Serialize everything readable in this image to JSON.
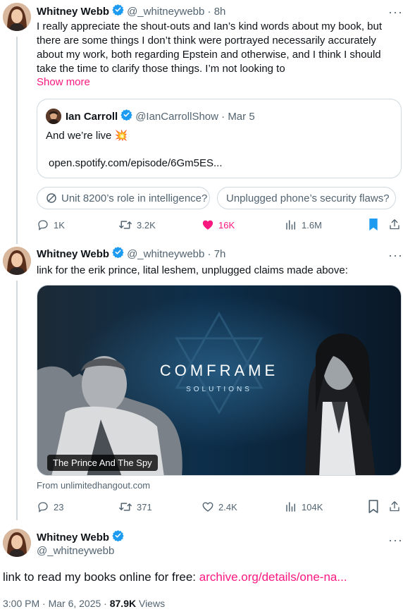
{
  "tweet1": {
    "name": "Whitney Webb",
    "handle": "@_whitneywebb",
    "time": "8h",
    "text": "I really appreciate the shout-outs and Ian’s kind words about my book, but there are some things I don’t think were portrayed necessarily accurately about my work, both regarding Epstein and otherwise, and I think I should take the time to clarify those things. I’m not looking to",
    "show_more": "Show more",
    "quote": {
      "name": "Ian Carroll",
      "handle": "@IanCarrollShow",
      "time": "Mar 5",
      "text": "And we’re live 💥",
      "link": "open.spotify.com/episode/6Gm5ES..."
    },
    "chips": [
      "Unit 8200’s role in intelligence?",
      "Unplugged phone’s security flaws?"
    ],
    "stats": {
      "replies": "1K",
      "reposts": "3.2K",
      "likes": "16K",
      "views": "1.6M"
    }
  },
  "tweet2": {
    "name": "Whitney Webb",
    "handle": "@_whitneywebb",
    "time": "7h",
    "text": "link for the erik prince, lital leshem, unplugged claims made above:",
    "media_logo": "COMFRAME",
    "media_logo_sub": "SOLUTIONS",
    "media_caption": "The Prince And The Spy",
    "media_source": "From unlimitedhangout.com",
    "stats": {
      "replies": "23",
      "reposts": "371",
      "likes": "2.4K",
      "views": "104K"
    }
  },
  "tweet3": {
    "name": "Whitney Webb",
    "handle": "@_whitneywebb",
    "text_prefix": "link to read my books online for free: ",
    "text_link": "archive.org/details/one-na...",
    "timestamp": "3:00 PM · Mar 6, 2025 · ",
    "views_count": "87.9K",
    "views_label": " Views"
  },
  "colors": {
    "accent_pink": "#f91880",
    "verified_blue": "#1d9bf0",
    "muted": "#536471"
  }
}
